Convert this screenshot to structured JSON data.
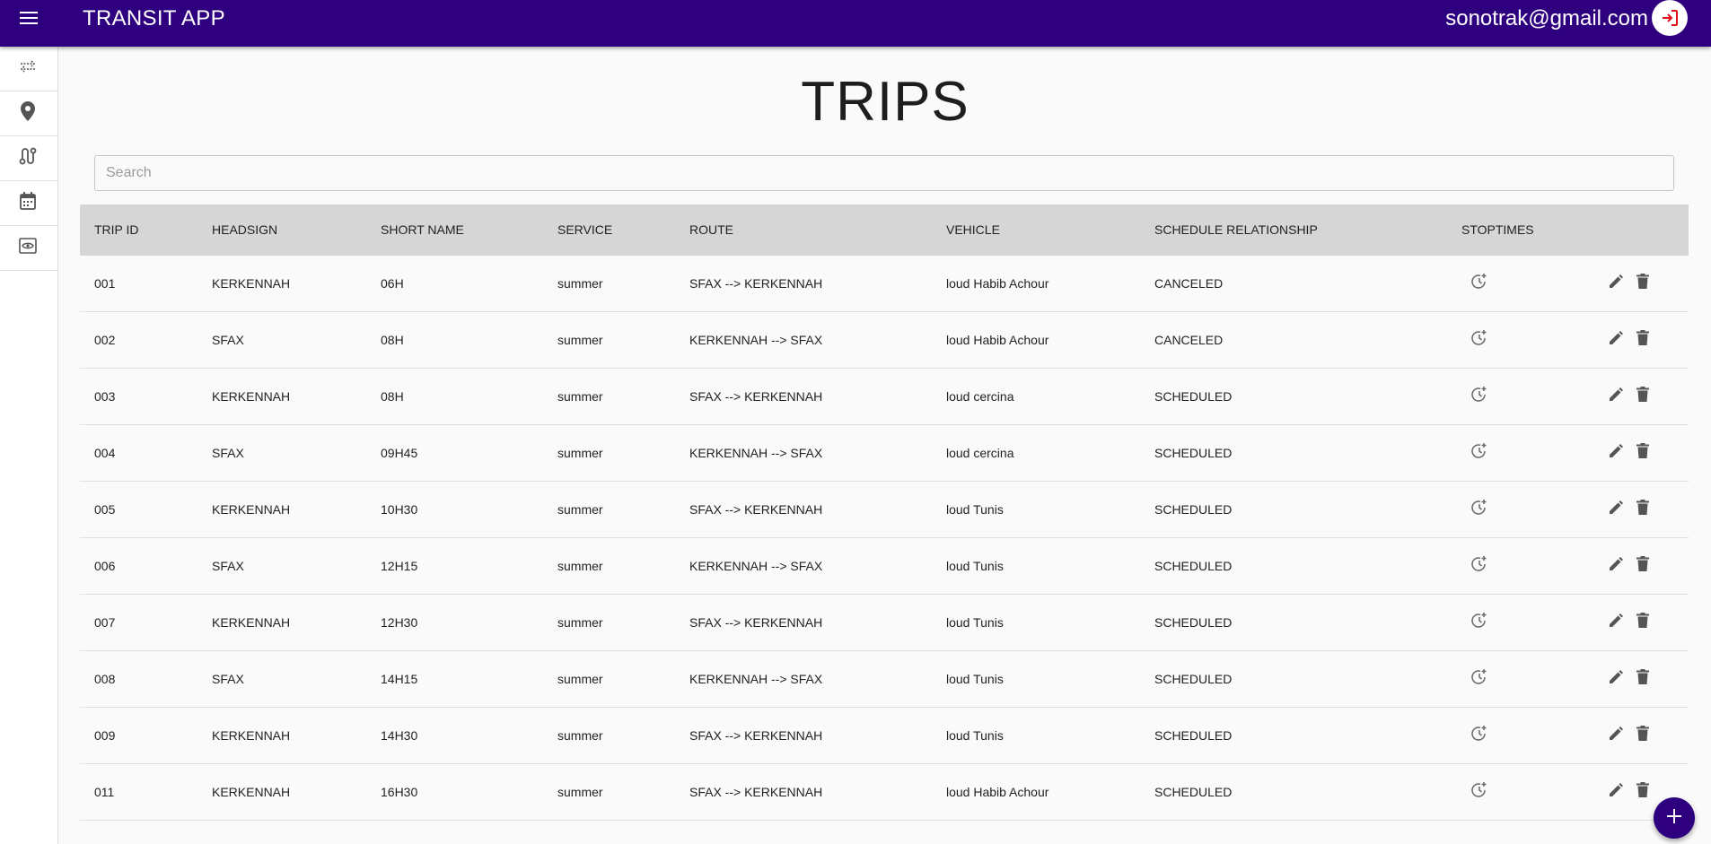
{
  "appbar": {
    "title": "TRANSIT APP",
    "user_email": "sonotrak@gmail.com",
    "menu_icon": "menu-icon",
    "logout_icon": "logout-icon",
    "bg_color": "#2e0080"
  },
  "sidebar": {
    "items": [
      {
        "name": "transfers",
        "icon": "swap-horiz-icon"
      },
      {
        "name": "stops",
        "icon": "location-pin-icon"
      },
      {
        "name": "routes",
        "icon": "route-icon"
      },
      {
        "name": "calendar",
        "icon": "calendar-icon"
      },
      {
        "name": "preview",
        "icon": "eye-icon"
      }
    ]
  },
  "page": {
    "title": "TRIPS",
    "search_placeholder": "Search"
  },
  "table": {
    "headers": [
      "TRIP ID",
      "HEADSIGN",
      "SHORT NAME",
      "SERVICE",
      "ROUTE",
      "VEHICLE",
      "SCHEDULE RELATIONSHIP",
      "STOPTIMES"
    ],
    "rows": [
      {
        "trip_id": "001",
        "headsign": "KERKENNAH",
        "short_name": "06H",
        "service": "summer",
        "route": "SFAX --> KERKENNAH",
        "vehicle": "loud Habib Achour",
        "schedule_relationship": "CANCELED"
      },
      {
        "trip_id": "002",
        "headsign": "SFAX",
        "short_name": "08H",
        "service": "summer",
        "route": "KERKENNAH --> SFAX",
        "vehicle": "loud Habib Achour",
        "schedule_relationship": "CANCELED"
      },
      {
        "trip_id": "003",
        "headsign": "KERKENNAH",
        "short_name": "08H",
        "service": "summer",
        "route": "SFAX --> KERKENNAH",
        "vehicle": "loud cercina",
        "schedule_relationship": "SCHEDULED"
      },
      {
        "trip_id": "004",
        "headsign": "SFAX",
        "short_name": "09H45",
        "service": "summer",
        "route": "KERKENNAH --> SFAX",
        "vehicle": "loud cercina",
        "schedule_relationship": "SCHEDULED"
      },
      {
        "trip_id": "005",
        "headsign": "KERKENNAH",
        "short_name": "10H30",
        "service": "summer",
        "route": "SFAX --> KERKENNAH",
        "vehicle": "loud Tunis",
        "schedule_relationship": "SCHEDULED"
      },
      {
        "trip_id": "006",
        "headsign": "SFAX",
        "short_name": "12H15",
        "service": "summer",
        "route": "KERKENNAH --> SFAX",
        "vehicle": "loud Tunis",
        "schedule_relationship": "SCHEDULED"
      },
      {
        "trip_id": "007",
        "headsign": "KERKENNAH",
        "short_name": "12H30",
        "service": "summer",
        "route": "SFAX --> KERKENNAH",
        "vehicle": "loud Tunis",
        "schedule_relationship": "SCHEDULED"
      },
      {
        "trip_id": "008",
        "headsign": "SFAX",
        "short_name": "14H15",
        "service": "summer",
        "route": "KERKENNAH --> SFAX",
        "vehicle": "loud Tunis",
        "schedule_relationship": "SCHEDULED"
      },
      {
        "trip_id": "009",
        "headsign": "KERKENNAH",
        "short_name": "14H30",
        "service": "summer",
        "route": "SFAX --> KERKENNAH",
        "vehicle": "loud Tunis",
        "schedule_relationship": "SCHEDULED"
      },
      {
        "trip_id": "011",
        "headsign": "KERKENNAH",
        "short_name": "16H30",
        "service": "summer",
        "route": "SFAX --> KERKENNAH",
        "vehicle": "loud Habib Achour",
        "schedule_relationship": "SCHEDULED"
      }
    ],
    "row_icons": {
      "stoptimes": "add-alarm-icon",
      "edit": "pencil-icon",
      "delete": "trash-icon"
    }
  },
  "fab": {
    "icon": "plus-icon"
  }
}
